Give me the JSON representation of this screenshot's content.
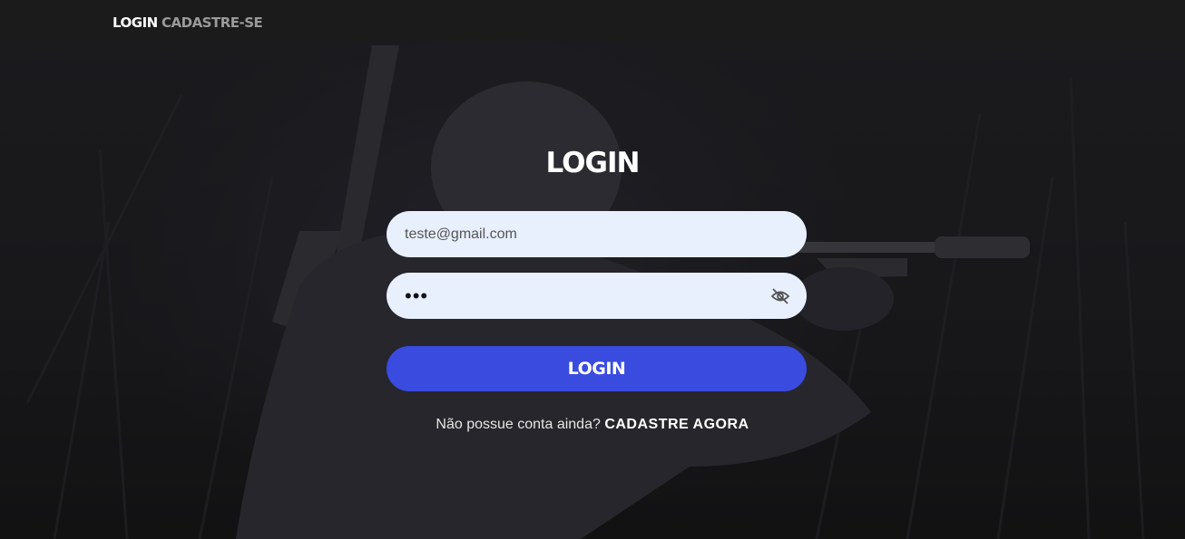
{
  "nav": {
    "login": "LOGIN",
    "signup": "CADASTRE-SE"
  },
  "form": {
    "title": "LOGIN",
    "email_value": "teste@gmail.com",
    "password_value": "•••",
    "password_icon": "eye-off-icon",
    "submit_label": "LOGIN",
    "no_account_text": "Não possue conta ainda?",
    "signup_cta": "CADASTRE AGORA"
  },
  "colors": {
    "accent": "#3a4be0",
    "input_bg": "#e8f0fe",
    "topbar": "#1b1b1b"
  }
}
